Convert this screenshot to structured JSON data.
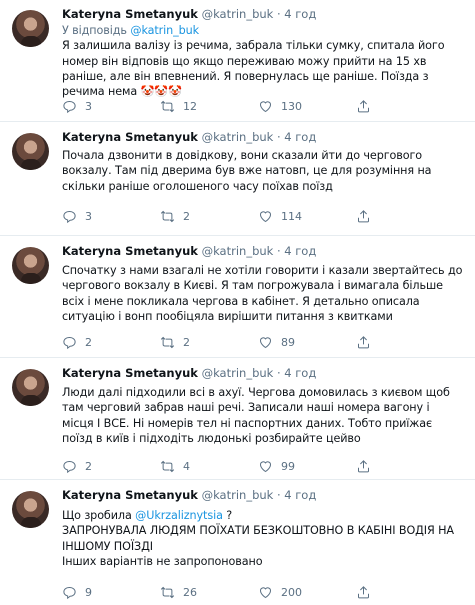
{
  "tweets": [
    {
      "name": "Kateryna Smetanyuk",
      "handle": "@katrin_buk",
      "time": "· 4 год",
      "reply_prefix": "У відповідь ",
      "reply_to": "@katrin_buk",
      "text": "Я залишила валізу із речима, забрала тільки сумку, спитала його номер він відповів що якщо переживаю можу прийти на 15 хв раніше, але він впевнений. Я повернулась ще раніше. Поїзда з речима нема 🤡🤡🤡",
      "replies": "3",
      "retweets": "12",
      "likes": "130"
    },
    {
      "name": "Kateryna Smetanyuk",
      "handle": "@katrin_buk",
      "time": "· 4 год",
      "text": "Почала дзвонити в довідкову, вони сказали йти до чергового вокзалу. Там під дверима був вже натовп, це для розуміння на скільки раніше оголошеного часу поїхав поїзд",
      "replies": "3",
      "retweets": "2",
      "likes": "114"
    },
    {
      "name": "Kateryna Smetanyuk",
      "handle": "@katrin_buk",
      "time": "· 4 год",
      "text": "Спочатку з нами взагалі не хотіли говорити і казали звертайтесь до чергового вокзалу в Києві. Я там погрожувала і вимагала більше всіх і мене покликала чергова в кабінет. Я детально описала ситуацію і вонп пообіцяла вирішити питання з квитками",
      "replies": "2",
      "retweets": "2",
      "likes": "89"
    },
    {
      "name": "Kateryna Smetanyuk",
      "handle": "@katrin_buk",
      "time": "· 4 год",
      "text": "Люди далі підходили всі в ахуї. Чергова домовилась з києвом щоб там черговий забрав наші речі. Записали наші номера вагону і місця І ВСЕ. Ні номерів тел ні паспортних даних. Тобто приїжає поїзд в київ і підходіть людонькі розбирайте цейво",
      "replies": "2",
      "retweets": "4",
      "likes": "99"
    },
    {
      "name": "Kateryna Smetanyuk",
      "handle": "@katrin_buk",
      "time": "· 4 год",
      "text_before": "Що зробила ",
      "mention": "@Ukrzaliznytsia",
      "text_after": " ?",
      "line2": "ЗАПРОНУВАЛА ЛЮДЯМ ПОЇХАТИ БЕЗКОШТОВНО В КАБІНІ ВОДІЯ НА ІНШОМУ ПОЇЗДІ",
      "line3": "Інших варіантів не запропоновано",
      "replies": "9",
      "retweets": "26",
      "likes": "200"
    }
  ],
  "icons": {
    "reply": "reply-icon",
    "retweet": "retweet-icon",
    "like": "heart-icon",
    "share": "share-icon"
  },
  "colors": {
    "link": "#1b95e0",
    "meta": "#5b7083",
    "divider": "#e6ecf0"
  }
}
